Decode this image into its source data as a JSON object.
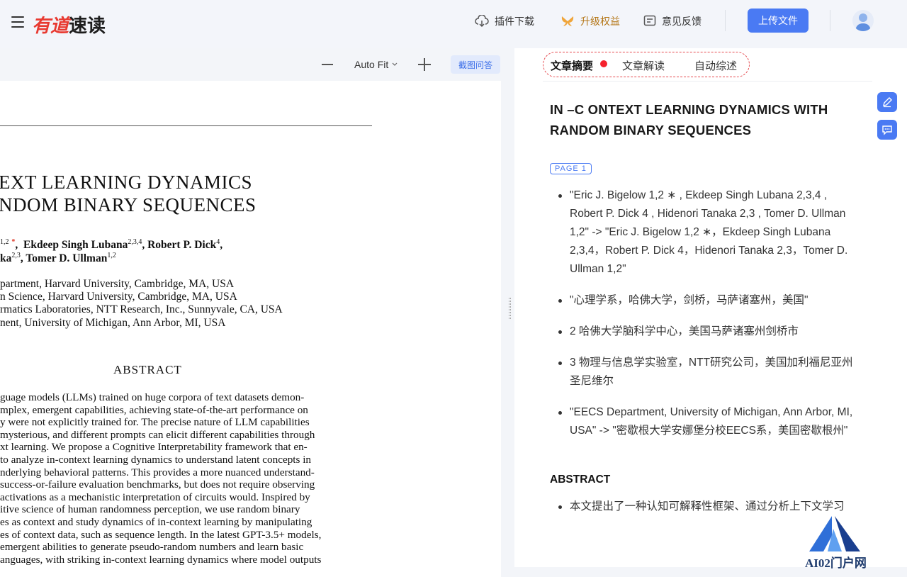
{
  "header": {
    "logo_part1": "有道",
    "logo_part2": "速读",
    "nav": {
      "plugin_download": "插件下载",
      "upgrade": "升级权益",
      "feedback": "意见反馈"
    },
    "upload_label": "上传文件"
  },
  "pdf_toolbar": {
    "zoom_label": "Auto Fit",
    "screenshot_qa": "截图问答"
  },
  "pdf": {
    "title_line1": "EXT LEARNING DYNAMICS",
    "title_line2": "NDOM BINARY SEQUENCES",
    "author_line1_sup": "1,2",
    "author_line1_star": "*",
    "author_line1_rest": "Ekdeep Singh Lubana",
    "author_line1_sup2": "2,3,4",
    "author_line1_mid": ", Robert P. Dick",
    "author_line1_sup3": "4",
    "author_line2_a": "ka",
    "author_line2_sup": "2,3",
    "author_line2_b": ", Tomer D. Ullman",
    "author_line2_sup2": "1,2",
    "aff1": "partment, Harvard University, Cambridge, MA, USA",
    "aff2": "n Science, Harvard University, Cambridge, MA, USA",
    "aff3": "rmatics Laboratories, NTT Research, Inc., Sunnyvale, CA, USA",
    "aff4": "nent, University of Michigan, Ann Arbor, MI, USA",
    "abstract_heading": "ABSTRACT",
    "abstract_lines": [
      "guage models (LLMs) trained on huge corpora of text datasets demon-",
      "mplex, emergent capabilities, achieving state-of-the-art performance on",
      "y were not explicitly trained for. The precise nature of LLM capabilities",
      "mysterious, and different prompts can elicit different capabilities through",
      "xt learning.  We propose a Cognitive Interpretability framework that en-",
      "to analyze in-context learning dynamics to understand latent concepts in",
      "nderlying behavioral patterns. This provides a more nuanced understand-",
      "success-or-failure evaluation benchmarks, but does not require observing",
      "activations as a mechanistic interpretation of circuits would. Inspired by",
      "itive science of human randomness perception, we use random binary",
      "es as context and study dynamics of in-context learning by manipulating",
      "es of context data, such as sequence length. In the latest GPT-3.5+ models,",
      "emergent abilities to generate pseudo-random numbers and learn basic",
      "anguages, with striking in-context learning dynamics where model outputs"
    ]
  },
  "summary": {
    "tabs": [
      "文章摘要",
      "文章解读",
      "自动综述"
    ],
    "title": "IN –C ONTEXT LEARNING DYNAMICS WITH RANDOM BINARY SEQUENCES",
    "page_badge": "PAGE 1",
    "bullets": [
      "\"Eric J. Bigelow 1,2 ∗ , Ekdeep Singh Lubana 2,3,4 , Robert P. Dick 4 , Hidenori Tanaka 2,3 , Tomer D. Ullman 1,2\" -> \"Eric J. Bigelow 1,2 ∗，Ekdeep Singh Lubana 2,3,4，Robert P. Dick 4，Hidenori Tanaka 2,3，Tomer D. Ullman 1,2\"",
      "\"心理学系，哈佛大学，剑桥，马萨诸塞州，美国\"",
      "2 哈佛大学脑科学中心，美国马萨诸塞州剑桥市",
      "3 物理与信息学实验室，NTT研究公司，美国加利福尼亚州圣尼维尔",
      "\"EECS Department, University of Michigan, Ann Arbor, MI, USA\" -> \"密歇根大学安娜堡分校EECS系，美国密歇根州\""
    ],
    "abstract_heading": "ABSTRACT",
    "abstract_bullets": [
      "本文提出了一种认知可解释性框架、通过分析上下文学习"
    ]
  },
  "watermark": "AI02门户网"
}
